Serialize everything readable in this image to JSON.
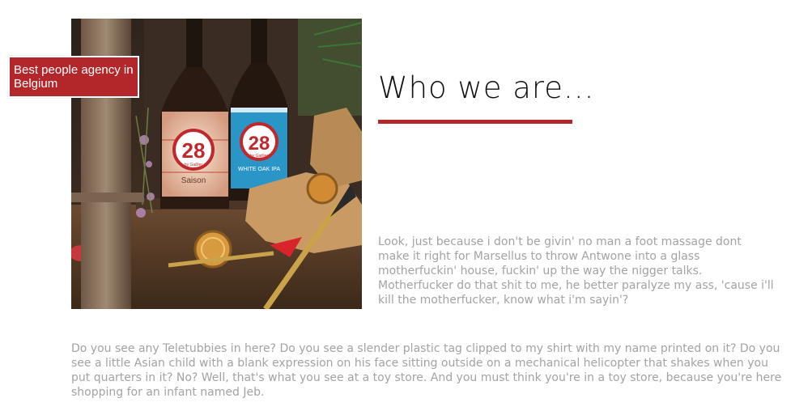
{
  "badge": {
    "text": "Best people agency in Belgium"
  },
  "hero": {
    "bottle_left": {
      "number": "28",
      "sub": "by Gaillier",
      "label": "Saison"
    },
    "bottle_right": {
      "number": "28",
      "sub": "by Gaillier",
      "label": "WHITE OAK IPA"
    }
  },
  "section": {
    "heading": "Who we are...",
    "intro": "Look, just because i don't be givin' no man a foot massage dont make it right for Marsellus to throw Antwone into a glass motherfuckin' house, fuckin' up the way the nigger talks. Motherfucker do that shit to me, he better paralyze my ass, 'cause i'll kill the motherfucker, know what i'm sayin'?",
    "body": "Do you see any Teletubbies in here? Do you see a slender plastic tag clipped to my shirt with my name printed on it? Do you see a little Asian child with a blank expression on his face sitting outside on a mechanical helicopter that shakes when you put quarters in it? No? Well, that's what you see at a toy store. And you must think you're in a toy store, because you're here shopping for an infant named Jeb."
  },
  "colors": {
    "accent": "#b3272b",
    "text_muted": "#a3a3a3",
    "heading": "#111111"
  }
}
